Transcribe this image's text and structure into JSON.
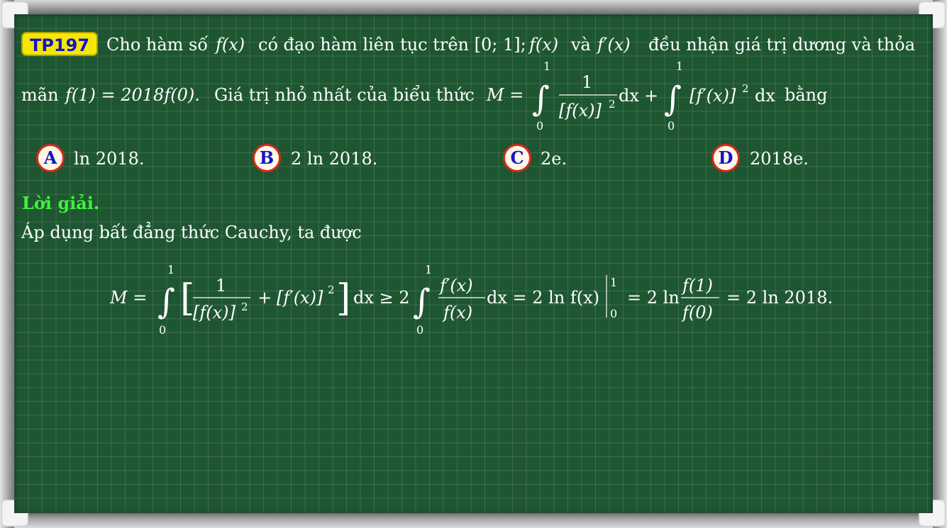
{
  "problem": {
    "tag": "TP197",
    "line1_a": "Cho hàm số",
    "line1_b": "có đạo hàm liên tục trên [0; 1];",
    "line1_c": "và",
    "line1_d": "đều nhận giá trị dương và thỏa",
    "fx": "f(x)",
    "fpx": "f′(x)",
    "line2_a": "mãn",
    "line2_condition": "f(1) = 2018f(0).",
    "line2_b": "Giá trị nhỏ nhất của biểu thức",
    "line2_c": "bằng",
    "expr_M": "M =",
    "int_upper": "1",
    "int_lower": "0",
    "frac_num": "1",
    "frac_den": "[f(x)]",
    "exp2": "2",
    "dx": "dx",
    "plus": "+",
    "sq_term": "[f′(x)]"
  },
  "options": [
    {
      "letter": "A",
      "text": "ln 2018."
    },
    {
      "letter": "B",
      "text": "2 ln 2018."
    },
    {
      "letter": "C",
      "text": "2e."
    },
    {
      "letter": "D",
      "text": "2018e."
    }
  ],
  "solution": {
    "heading": "Lời giải.",
    "intro": "Áp dụng bất đẳng thức Cauchy, ta được",
    "lhs": "M =",
    "ge2": "dx ≥ 2",
    "num2": "f′(x)",
    "den2": "f(x)",
    "eq_part": "dx = 2 ln f(x)",
    "eq2": "= 2 ln",
    "num3": "f(1)",
    "den3": "f(0)",
    "result": "= 2 ln 2018."
  },
  "colors": {
    "board": "#1e5631",
    "tag_bg": "#f5e800",
    "tag_text": "#1414c8",
    "option_border": "#d6281c",
    "heading": "#3ef23e"
  }
}
